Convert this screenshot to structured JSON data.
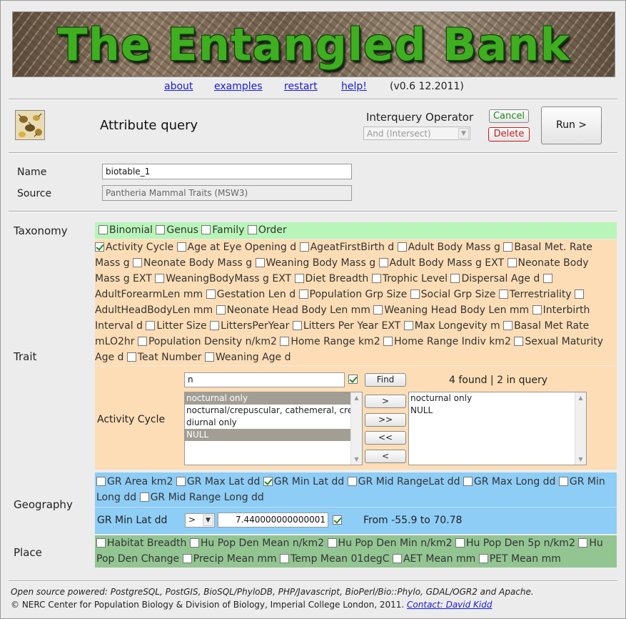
{
  "banner": {
    "title": "The Entangled Bank"
  },
  "nav": {
    "about": "about",
    "examples": "examples",
    "restart": "restart",
    "help": "help!",
    "version": "(v0.6 12.2011)"
  },
  "query": {
    "title": "Attribute query",
    "interquery_label": "Interquery Operator",
    "interquery_value": "And (Intersect)",
    "cancel": "Cancel",
    "delete": "Delete",
    "run": "Run >"
  },
  "form": {
    "name_label": "Name",
    "name_value": "biotable_1",
    "source_label": "Source",
    "source_value": "Pantheria Mammal Traits (MSW3)"
  },
  "taxonomy": {
    "label": "Taxonomy",
    "options": [
      {
        "label": "Binomial",
        "checked": false
      },
      {
        "label": "Genus",
        "checked": false
      },
      {
        "label": "Family",
        "checked": false
      },
      {
        "label": "Order",
        "checked": false
      }
    ]
  },
  "trait": {
    "label": "Trait",
    "options": [
      {
        "label": "Activity Cycle",
        "checked": true
      },
      {
        "label": "Age at Eye Opening d",
        "checked": false
      },
      {
        "label": "AgeatFirstBirth d",
        "checked": false
      },
      {
        "label": "Adult Body Mass g",
        "checked": false
      },
      {
        "label": "Basal Met. Rate Mass g",
        "checked": false
      },
      {
        "label": "Neonate Body Mass g",
        "checked": false
      },
      {
        "label": "Weaning Body Mass g",
        "checked": false
      },
      {
        "label": "Adult Body Mass g EXT",
        "checked": false
      },
      {
        "label": "Neonate Body Mass g EXT",
        "checked": false
      },
      {
        "label": "WeaningBodyMass g EXT",
        "checked": false
      },
      {
        "label": "Diet Breadth",
        "checked": false
      },
      {
        "label": "Trophic Level",
        "checked": false
      },
      {
        "label": "Dispersal Age d",
        "checked": false
      },
      {
        "label": "AdultForearmLen mm",
        "checked": false
      },
      {
        "label": "Gestation Len d",
        "checked": false
      },
      {
        "label": "Population Grp Size",
        "checked": false
      },
      {
        "label": "Social Grp Size",
        "checked": false
      },
      {
        "label": "Terrestriality",
        "checked": false
      },
      {
        "label": "AdultHeadBodyLen mm",
        "checked": false
      },
      {
        "label": "Neonate Head Body Len mm",
        "checked": false
      },
      {
        "label": "Weaning Head Body Len mm",
        "checked": false
      },
      {
        "label": "Interbirth Interval d",
        "checked": false
      },
      {
        "label": "Litter Size",
        "checked": false
      },
      {
        "label": "LittersPerYear",
        "checked": false
      },
      {
        "label": "Litters Per Year EXT",
        "checked": false
      },
      {
        "label": "Max Longevity m",
        "checked": false
      },
      {
        "label": "Basal Met Rate mLO2hr",
        "checked": false
      },
      {
        "label": "Population Density n/km2",
        "checked": false
      },
      {
        "label": "Home Range km2",
        "checked": false
      },
      {
        "label": "Home Range Indiv km2",
        "checked": false
      },
      {
        "label": "Sexual Maturity Age d",
        "checked": false
      },
      {
        "label": "Teat Number",
        "checked": false
      },
      {
        "label": "Weaning Age d",
        "checked": false
      }
    ],
    "editor": {
      "label": "Activity Cycle",
      "filter_value": "n",
      "filter_checked": true,
      "find": "Find",
      "count_text": "4 found | 2 in query",
      "available": [
        {
          "label": "nocturnal only",
          "selected": true
        },
        {
          "label": "nocturnal/crepuscular, cathemeral, crep",
          "selected": false
        },
        {
          "label": "diurnal only",
          "selected": false
        },
        {
          "label": "NULL",
          "selected": true
        }
      ],
      "chosen": [
        "nocturnal only",
        "NULL"
      ],
      "move_buttons": [
        ">",
        ">>",
        "<<",
        "<"
      ]
    }
  },
  "geography": {
    "label": "Geography",
    "options": [
      {
        "label": "GR Area km2",
        "checked": false
      },
      {
        "label": "GR Max Lat dd",
        "checked": false
      },
      {
        "label": "GR Min Lat dd",
        "checked": true
      },
      {
        "label": "GR Mid RangeLat dd",
        "checked": false
      },
      {
        "label": "GR Max Long dd",
        "checked": false
      },
      {
        "label": "GR Min Long dd",
        "checked": false
      },
      {
        "label": "GR Mid Range Long dd",
        "checked": false
      }
    ],
    "editor": {
      "label": "GR Min Lat dd",
      "operator": ">",
      "value": "7.440000000000001",
      "checked": true,
      "range_text": "From -55.9 to 70.78"
    }
  },
  "place": {
    "label": "Place",
    "options": [
      {
        "label": "Habitat Breadth",
        "checked": false
      },
      {
        "label": "Hu Pop Den Mean n/km2",
        "checked": false
      },
      {
        "label": "Hu Pop Den Min n/km2",
        "checked": false
      },
      {
        "label": "Hu Pop Den 5p n/km2",
        "checked": false
      },
      {
        "label": "Hu Pop Den Change",
        "checked": false
      },
      {
        "label": "Precip Mean mm",
        "checked": false
      },
      {
        "label": "Temp Mean 01degC",
        "checked": false
      },
      {
        "label": "AET Mean mm",
        "checked": false
      },
      {
        "label": "PET Mean mm",
        "checked": false
      }
    ]
  },
  "footer": {
    "powered": "Open source powered: PostgreSQL, PostGIS, BioSQL/PhyloDB, PHP/Javascript, BioPerl/Bio::Phylo, GDAL/OGR2 and Apache.",
    "copyright": "© NERC Center for Population Biology & Division of Biology, Imperial College London, 2011.",
    "contact": "Contact: David Kidd"
  },
  "colors": {
    "taxonomy_bg": "#b8f5b8",
    "trait_bg": "#fdddb6",
    "geography_bg": "#8ecdf6",
    "place_bg": "#93c593",
    "banner_text": "#3fae21"
  }
}
